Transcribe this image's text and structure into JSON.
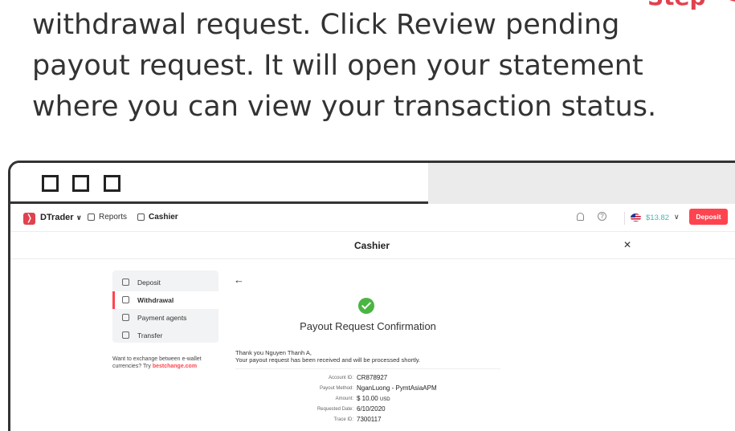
{
  "instruction": {
    "lines": [
      "withdrawal request. Click Review pending",
      "payout request. It will open your statement",
      "where you can view your transaction status."
    ],
    "step_label": "Step"
  },
  "app": {
    "brand": "DTrader",
    "nav": {
      "reports": "Reports",
      "cashier": "Cashier"
    },
    "balance": "$13.82",
    "deposit_label": "Deposit"
  },
  "cashier": {
    "title": "Cashier",
    "menu": [
      {
        "label": "Deposit",
        "active": false
      },
      {
        "label": "Withdrawal",
        "active": true
      },
      {
        "label": "Payment agents",
        "active": false
      },
      {
        "label": "Transfer",
        "active": false
      }
    ],
    "exchange_note": "Want to exchange between e-wallet currencies? Try",
    "exchange_link": "bestchange.com"
  },
  "confirmation": {
    "title": "Payout Request Confirmation",
    "thanks_line1": "Thank you Nguyen Thanh A,",
    "thanks_line2": "Your payout request has been received and will be processed shortly.",
    "details": [
      {
        "label": "Account ID:",
        "value": "CR878927"
      },
      {
        "label": "Payout Method:",
        "value": "NganLuong - PymtAsiaAPM"
      },
      {
        "label": "Amount:",
        "value": "$ 10.00",
        "unit": "USD"
      },
      {
        "label": "Requested Date:",
        "value": "6/10/2020"
      },
      {
        "label": "Trace ID:",
        "value": "7300117"
      }
    ]
  },
  "colors": {
    "accent": "#ff444f",
    "step_red": "#e1414f",
    "success": "#4bb543",
    "balance": "#4bb4b3"
  },
  "icons": [
    "bell-icon",
    "help-icon",
    "us-flag-icon",
    "checkmark-icon",
    "back-arrow-icon",
    "close-icon"
  ]
}
